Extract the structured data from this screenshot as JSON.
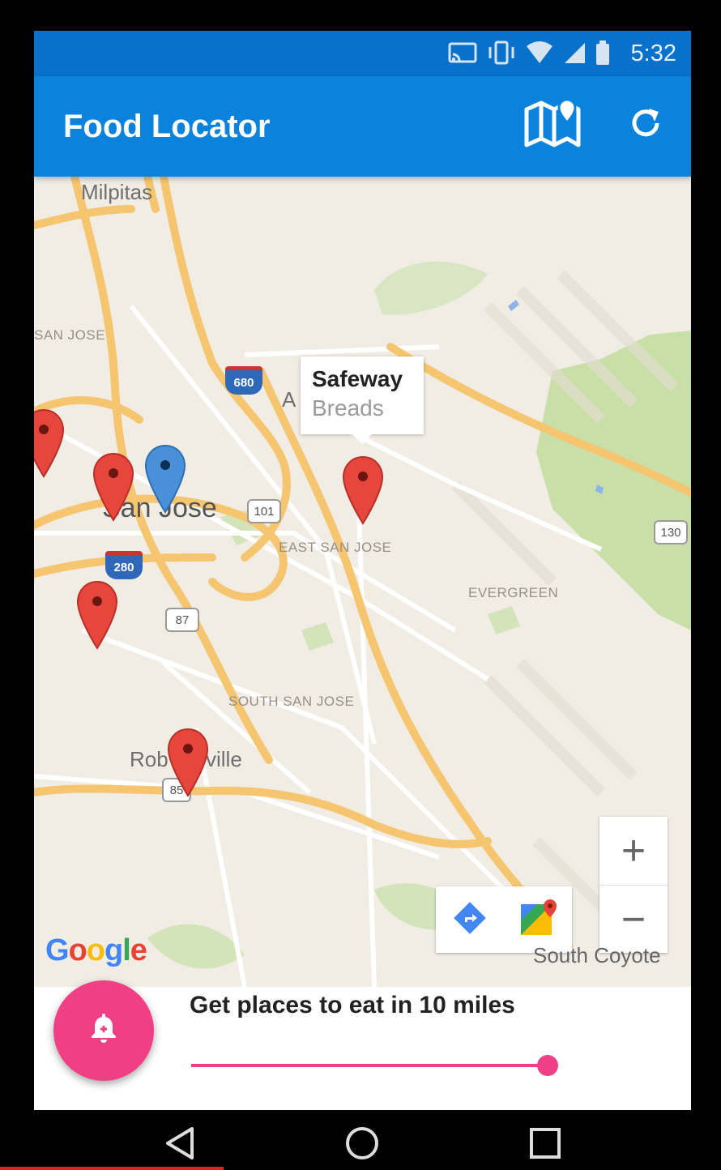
{
  "status_bar": {
    "time": "5:32",
    "icons": [
      "cast-icon",
      "vibrate-icon",
      "wifi-icon",
      "signal-icon",
      "battery-icon"
    ]
  },
  "app_bar": {
    "title": "Food Locator",
    "actions": [
      "map-icon",
      "refresh-icon"
    ],
    "color": "#0b82dc"
  },
  "map": {
    "places": {
      "milpitas": "Milpitas",
      "san_jose_top": "SAN JOSE",
      "alum_rock_partial": "A",
      "san_jose": "San Jose",
      "east_san_jose": "EAST SAN JOSE",
      "evergreen": "EVERGREEN",
      "south_san_jose": "SOUTH SAN JOSE",
      "robertsville_a": "Rob",
      "robertsville_b": "ville",
      "south_coyote": "South Coyote"
    },
    "highways": {
      "i680": "680",
      "us101": "101",
      "i280": "280",
      "ca87": "87",
      "ca85": "85",
      "ca130": "130"
    },
    "info_window": {
      "title": "Safeway",
      "subtitle": "Breads"
    },
    "markers": {
      "red_count": 5,
      "blue_count": 1,
      "red_color": "#e8453c",
      "blue_color": "#4a90d9"
    },
    "zoom_in": "+",
    "zoom_out": "−",
    "toolbar": [
      "directions-icon",
      "google-maps-icon"
    ],
    "attribution": "Google"
  },
  "bottom_panel": {
    "label": "Get places to eat in 10 miles",
    "slider_fraction": 1.0,
    "accent": "#f13f86",
    "fab_icon": "notification-bell-icon"
  },
  "nav_bar": {
    "buttons": [
      "back-icon",
      "home-icon",
      "recents-icon"
    ]
  }
}
